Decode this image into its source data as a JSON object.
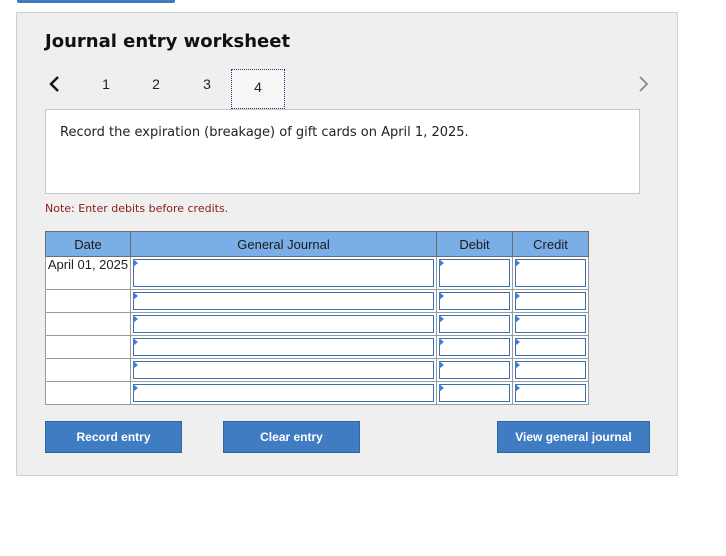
{
  "header": {
    "title": "Journal entry worksheet"
  },
  "steps": {
    "items": [
      "1",
      "2",
      "3",
      "4"
    ],
    "active_index": 3
  },
  "prompt": {
    "text": "Record the expiration (breakage) of gift cards on April 1, 2025."
  },
  "note": {
    "text": "Note: Enter debits before credits."
  },
  "table": {
    "headers": {
      "date": "Date",
      "journal": "General Journal",
      "debit": "Debit",
      "credit": "Credit"
    },
    "rows": [
      {
        "date": "April 01, 2025"
      },
      {
        "date": ""
      },
      {
        "date": ""
      },
      {
        "date": ""
      },
      {
        "date": ""
      },
      {
        "date": ""
      }
    ]
  },
  "buttons": {
    "record": "Record entry",
    "clear": "Clear entry",
    "view": "View general journal"
  },
  "colors": {
    "accent": "#3f7cc2",
    "header_bg": "#7aaee6",
    "note": "#8b1a1a"
  },
  "icons": {
    "prev": "chevron-left-icon",
    "next": "chevron-right-icon"
  }
}
